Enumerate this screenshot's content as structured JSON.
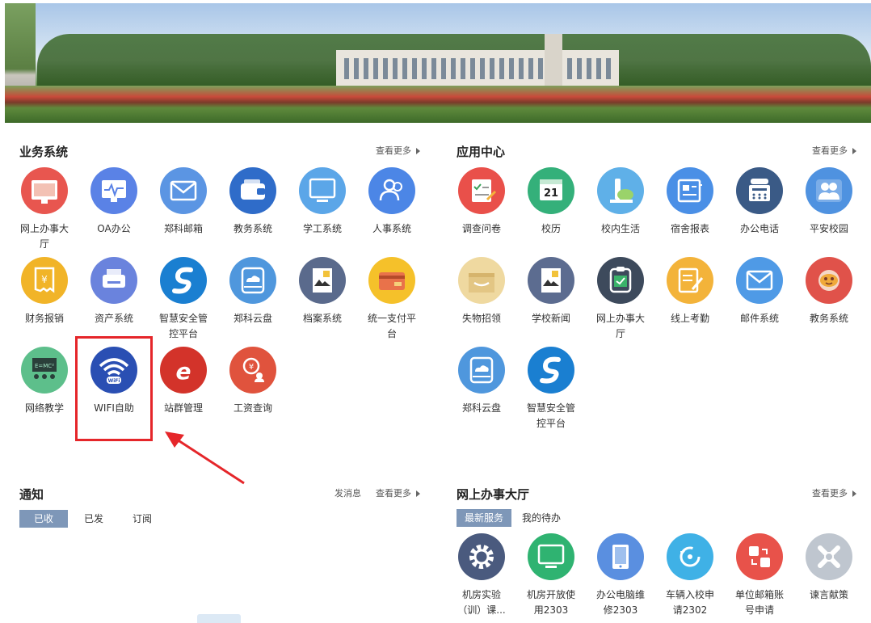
{
  "business": {
    "title": "业务系统",
    "more": "查看更多",
    "apps": [
      {
        "label": "网上办事大厅",
        "icon": "browser-grid-icon",
        "color": "#e8564f"
      },
      {
        "label": "OA办公",
        "icon": "monitor-pulse-icon",
        "color": "#5a82e6"
      },
      {
        "label": "郑科邮箱",
        "icon": "envelope-icon",
        "color": "#5b95e3"
      },
      {
        "label": "教务系统",
        "icon": "wallet-icon",
        "color": "#2f6cc9"
      },
      {
        "label": "学工系统",
        "icon": "monitor-icon",
        "color": "#5ba6e8"
      },
      {
        "label": "人事系统",
        "icon": "people-icon",
        "color": "#4c86e6"
      },
      {
        "label": "财务报销",
        "icon": "receipt-icon",
        "color": "#f1b428"
      },
      {
        "label": "资产系统",
        "icon": "printer-icon",
        "color": "#6a83dd"
      },
      {
        "label": "智慧安全管控平台",
        "icon": "s-logo-icon",
        "color": "#1a7fd1"
      },
      {
        "label": "郑科云盘",
        "icon": "cloud-drive-icon",
        "color": "#4f97dd"
      },
      {
        "label": "档案系统",
        "icon": "document-icon",
        "color": "#5a6a8c"
      },
      {
        "label": "统一支付平台",
        "icon": "card-icon",
        "color": "#f5c12a"
      },
      {
        "label": "网络教学",
        "icon": "classroom-icon",
        "color": "#5dbf8b"
      },
      {
        "label": "WIFI自助",
        "icon": "wifi-icon",
        "color": "#2a4fb3"
      },
      {
        "label": "站群管理",
        "icon": "ie-icon",
        "color": "#d3332a"
      },
      {
        "label": "工资查询",
        "icon": "salary-icon",
        "color": "#e0533d"
      }
    ]
  },
  "appcenter": {
    "title": "应用中心",
    "more": "查看更多",
    "apps": [
      {
        "label": "调查问卷",
        "icon": "survey-icon",
        "color": "#e9504a"
      },
      {
        "label": "校历",
        "icon": "calendar-icon",
        "color": "#34b07a",
        "badge": "21"
      },
      {
        "label": "校内生活",
        "icon": "life-icon",
        "color": "#5fb0e8"
      },
      {
        "label": "宿舍报表",
        "icon": "newspaper-icon",
        "color": "#4a8fe6"
      },
      {
        "label": "办公电话",
        "icon": "phone-icon",
        "color": "#3a5a86"
      },
      {
        "label": "平安校园",
        "icon": "people-group-icon",
        "color": "#4f92e0"
      },
      {
        "label": "失物招领",
        "icon": "box-icon",
        "color": "#efd9a0"
      },
      {
        "label": "学校新闻",
        "icon": "document-icon",
        "color": "#5c6c90"
      },
      {
        "label": "网上办事大厅",
        "icon": "clipboard-check-icon",
        "color": "#3d4a5c"
      },
      {
        "label": "线上考勤",
        "icon": "edit-note-icon",
        "color": "#f3b33a"
      },
      {
        "label": "邮件系统",
        "icon": "envelope-icon",
        "color": "#4f9ae6"
      },
      {
        "label": "教务系统",
        "icon": "mask-icon",
        "color": "#e0524a"
      },
      {
        "label": "郑科云盘",
        "icon": "cloud-drive-icon",
        "color": "#4f97dd"
      },
      {
        "label": "智慧安全管控平台",
        "icon": "s-logo-icon",
        "color": "#1a7fd1"
      }
    ]
  },
  "notice": {
    "title": "通知",
    "send": "发消息",
    "more": "查看更多",
    "tabs": [
      "已收",
      "已发",
      "订阅"
    ]
  },
  "hall": {
    "title": "网上办事大厅",
    "more": "查看更多",
    "tabs": [
      "最新服务",
      "我的待办"
    ],
    "apps": [
      {
        "label": "机房实验（训）课...",
        "icon": "gear-icon",
        "color": "#4a5a7e"
      },
      {
        "label": "机房开放使用2303",
        "icon": "monitor-icon",
        "color": "#2fb371"
      },
      {
        "label": "办公电脑维修2303",
        "icon": "tablet-icon",
        "color": "#5a8fe0"
      },
      {
        "label": "车辆入校申请2302",
        "icon": "refresh-icon",
        "color": "#3fb1e6"
      },
      {
        "label": "单位邮箱账号申请",
        "icon": "transfer-icon",
        "color": "#e8524a"
      },
      {
        "label": "谏言献策",
        "icon": "puzzle-icon",
        "color": "#bfc6cf"
      }
    ]
  }
}
